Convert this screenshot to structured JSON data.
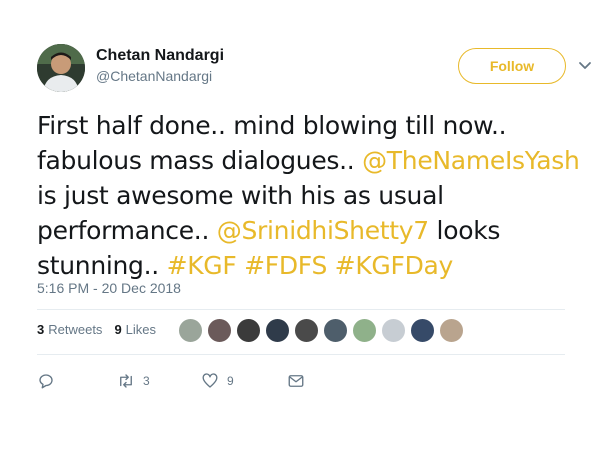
{
  "author": {
    "name": "Chetan Nandargi",
    "handle": "@ChetanNandargi"
  },
  "follow_label": "Follow",
  "tweet": {
    "text_parts": [
      "First half done.. mind blowing till now.. fabulous mass dialogues.. ",
      "@TheNameIsYash",
      " is just awesome with his as usual performance.. ",
      "@SrinidhiShetty7",
      " looks stunning.. ",
      "#KGF",
      " ",
      "#FDFS",
      " ",
      "#KGFDay"
    ],
    "timestamp": "5:16 PM - 20 Dec 2018"
  },
  "stats": {
    "retweets_count": "3",
    "retweets_label": "Retweets",
    "likes_count": "9",
    "likes_label": "Likes"
  },
  "actions": {
    "retweet_count": "3",
    "like_count": "9"
  },
  "likers": [
    "#9aa59a",
    "#6b5a5a",
    "#3b3b3b",
    "#2f3b4a",
    "#4a4a4a",
    "#4e5e6b",
    "#8fb18a",
    "#c7cdd3",
    "#364a68",
    "#b9a48e"
  ],
  "colors": {
    "accent": "#e8b92a",
    "muted": "#657786",
    "text": "#14171a"
  }
}
